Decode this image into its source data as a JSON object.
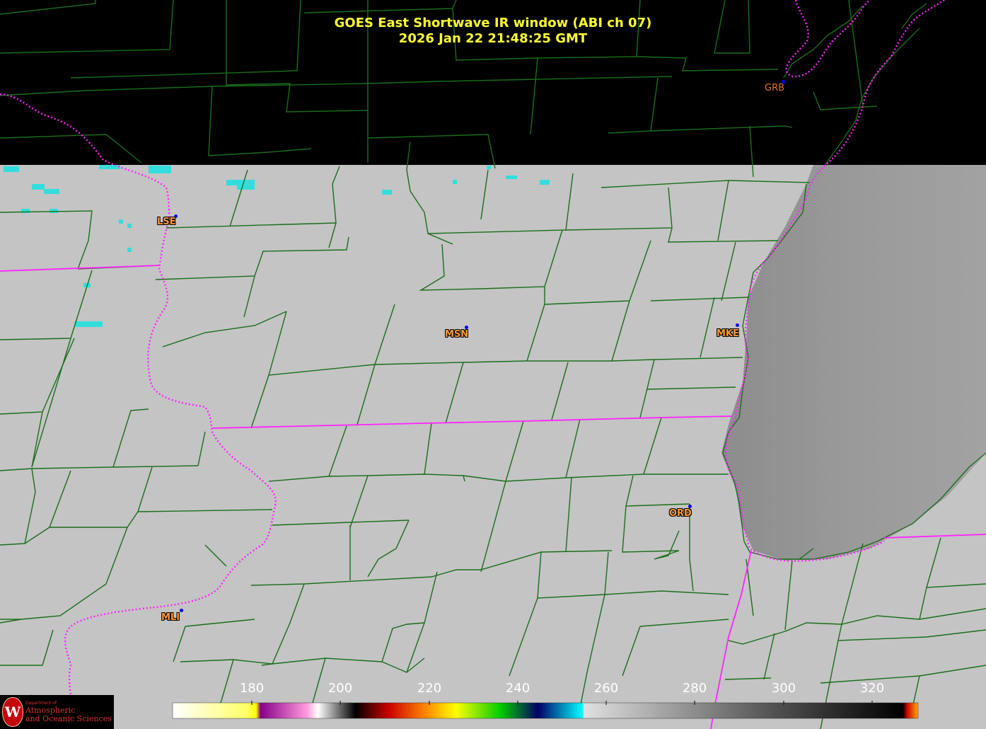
{
  "title": {
    "line1": "GOES East Shortwave IR window (ABI ch 07)",
    "line2": "2026 Jan 22  21:48:25 GMT"
  },
  "colors": {
    "background": "#000000",
    "cloud_gray": "#c8c8c8",
    "county_lines": "#1a6e1a",
    "state_lines": "#ff22ff",
    "cold_cyan": "#33dddd",
    "title_text": "#ffff33",
    "station_text": "#ff9a3c",
    "station_dot": "#0000ff"
  },
  "stations": [
    {
      "id": "LSE",
      "marker": "blue-dot"
    },
    {
      "id": "MSN",
      "marker": "blue-dot"
    },
    {
      "id": "MKE",
      "marker": "blue-dot"
    },
    {
      "id": "ORD",
      "marker": "blue-dot"
    },
    {
      "id": "MLI",
      "marker": "blue-dot"
    },
    {
      "id": "GRB",
      "marker": "blue-dot"
    }
  ],
  "colorbar": {
    "ticks": [
      "180",
      "200",
      "220",
      "240",
      "260",
      "280",
      "300",
      "320"
    ]
  },
  "logo": {
    "seal_letter": "W",
    "department": "Department of",
    "line1": "Atmospheric",
    "line2": "and Oceanic Sciences"
  }
}
